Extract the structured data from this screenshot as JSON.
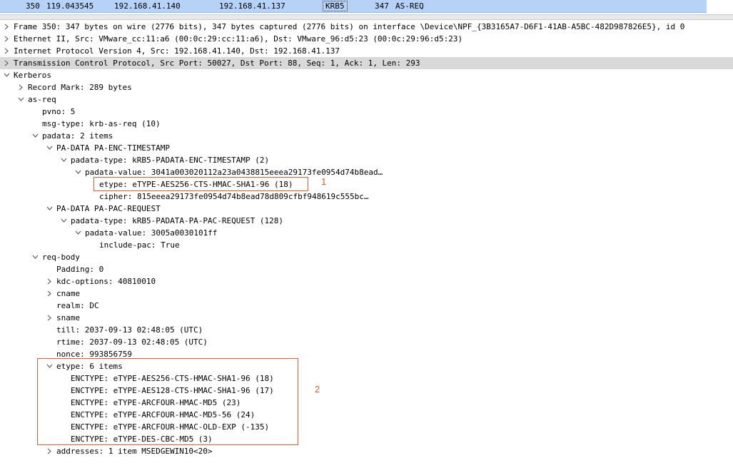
{
  "packet_list": {
    "selected_row": {
      "no": "350",
      "time": "119.043545",
      "source": "192.168.41.140",
      "destination": "192.168.41.137",
      "protocol": "KRB5",
      "length": "347",
      "info": "AS-REQ"
    }
  },
  "tree": {
    "frame": "Frame 350: 347 bytes on wire (2776 bits), 347 bytes captured (2776 bits) on interface \\Device\\NPF_{3B3165A7-D6F1-41AB-A5BC-482D987826E5}, id 0",
    "ethernet": "Ethernet II, Src: VMware_cc:11:a6 (00:0c:29:cc:11:a6), Dst: VMware_96:d5:23 (00:0c:29:96:d5:23)",
    "ip": "Internet Protocol Version 4, Src: 192.168.41.140, Dst: 192.168.41.137",
    "tcp": "Transmission Control Protocol, Src Port: 50027, Dst Port: 88, Seq: 1, Ack: 1, Len: 293",
    "kerberos": "Kerberos",
    "record_mark": "Record Mark: 289 bytes",
    "as_req": "as-req",
    "pvno": "pvno: 5",
    "msg_type": "msg-type: krb-as-req (10)",
    "padata": "padata: 2 items",
    "pa_enc_ts": "PA-DATA PA-ENC-TIMESTAMP",
    "padata_type_1": "padata-type: kRB5-PADATA-ENC-TIMESTAMP (2)",
    "padata_value_1": "padata-value: 3041a003020112a23a0438815eeea29173fe0954d74b8ead…",
    "etype_enc": "etype: eTYPE-AES256-CTS-HMAC-SHA1-96 (18)",
    "cipher": "cipher: 815eeea29173fe0954d74b8ead78d809cfbf948619c555bc…",
    "pa_pac_req": "PA-DATA PA-PAC-REQUEST",
    "padata_type_2": "padata-type: kRB5-PADATA-PA-PAC-REQUEST (128)",
    "padata_value_2": "padata-value: 3005a0030101ff",
    "include_pac": "include-pac: True",
    "req_body": "req-body",
    "padding": "Padding: 0",
    "kdc_options": "kdc-options: 40810010",
    "cname": "cname",
    "realm": "realm: DC",
    "sname": "sname",
    "till": "till: 2037-09-13 02:48:05 (UTC)",
    "rtime": "rtime: 2037-09-13 02:48:05 (UTC)",
    "nonce": "nonce: 993856759",
    "etype_list": "etype: 6 items",
    "enctypes": [
      "ENCTYPE: eTYPE-AES256-CTS-HMAC-SHA1-96 (18)",
      "ENCTYPE: eTYPE-AES128-CTS-HMAC-SHA1-96 (17)",
      "ENCTYPE: eTYPE-ARCFOUR-HMAC-MD5 (23)",
      "ENCTYPE: eTYPE-ARCFOUR-HMAC-MD5-56 (24)",
      "ENCTYPE: eTYPE-ARCFOUR-HMAC-OLD-EXP (-135)",
      "ENCTYPE: eTYPE-DES-CBC-MD5 (3)"
    ],
    "addresses": "addresses: 1 item MSEDGEWIN10<20>"
  },
  "annotations": {
    "note_1": "1",
    "note_2": "2",
    "color": "#e35b2c"
  },
  "colors": {
    "selected_packet_bg": "#b7d2f7",
    "selected_tree_row_bg": "#d9d9d9"
  }
}
